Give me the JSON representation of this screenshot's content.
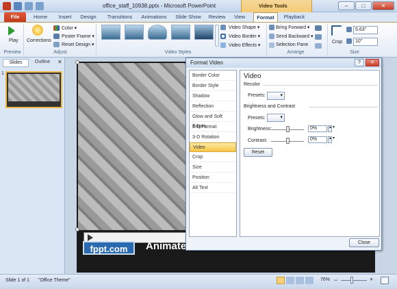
{
  "titlebar": {
    "title": "office_staff_10938.pptx - Microsoft PowerPoint",
    "context_tab_group": "Video Tools",
    "min": "–",
    "max": "□",
    "close": "✕"
  },
  "tabs": [
    "File",
    "Home",
    "Insert",
    "Design",
    "Transitions",
    "Animations",
    "Slide Show",
    "Review",
    "View",
    "Format",
    "Playback"
  ],
  "ribbon": {
    "preview": {
      "play": "Play",
      "group": "Preview"
    },
    "adjust": {
      "corrections": "Corrections",
      "color": "Color ▾",
      "poster": "Poster Frame ▾",
      "reset": "Reset Design ▾",
      "group": "Adjust"
    },
    "styles": {
      "group": "Video Styles",
      "shape": "Video Shape ▾",
      "border": "Video Border ▾",
      "effects": "Video Effects ▾"
    },
    "arrange": {
      "forward": "Bring Forward ▾",
      "backward": "Send Backward ▾",
      "pane": "Selection Pane",
      "group": "Arrange"
    },
    "size": {
      "crop": "Crop",
      "height": "5.63\"",
      "width": "10\"",
      "group": "Size"
    }
  },
  "leftpane": {
    "tab_slides": "Slides",
    "tab_outline": "Outline",
    "close": "✕",
    "slide_number": "1"
  },
  "slide": {
    "logo": "fppt.com",
    "banner": "Animate"
  },
  "dialog": {
    "title": "Format Video",
    "help": "?",
    "close": "✕",
    "nav": [
      "Border Color",
      "Border Style",
      "Shadow",
      "Reflection",
      "Glow and Soft Edges",
      "3-D Format",
      "3-D Rotation",
      "Video",
      "Crop",
      "Size",
      "Position",
      "Alt Text"
    ],
    "panel": {
      "heading": "Video",
      "recolor": "Recolor",
      "presets_label": "Presets:",
      "brightness_contrast": "Brightness and Contrast",
      "presets2_label": "Presets:",
      "brightness_label": "Brightness:",
      "brightness_value": "0%",
      "contrast_label": "Contrast:",
      "contrast_value": "0%",
      "reset": "Reset"
    },
    "close_button": "Close"
  },
  "status": {
    "slide": "Slide 1 of 1",
    "theme": "\"Office Theme\"",
    "zoom": "76%",
    "minus": "−",
    "plus": "+"
  }
}
